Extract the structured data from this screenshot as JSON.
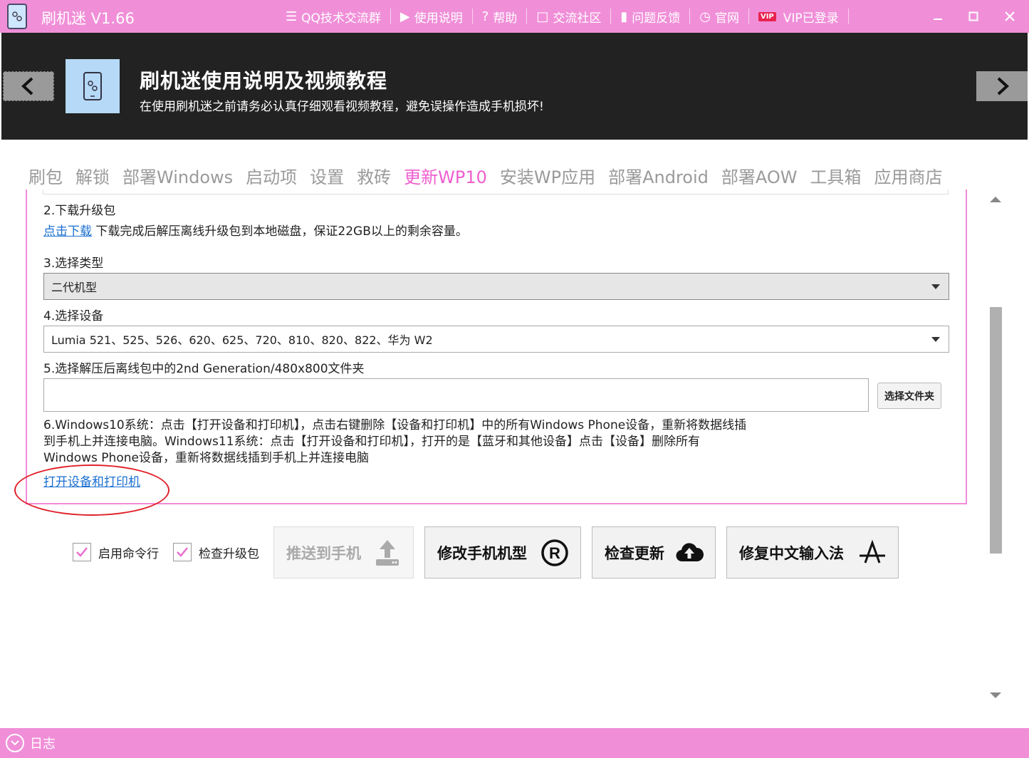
{
  "app": {
    "title": "刷机迷 V1.66"
  },
  "titlebar_menu": [
    {
      "label": "QQ技术交流群",
      "icon": "qq-group-icon"
    },
    {
      "label": "使用说明",
      "icon": "video-icon"
    },
    {
      "label": "帮助",
      "icon": "help-icon"
    },
    {
      "label": "交流社区",
      "icon": "chat-icon"
    },
    {
      "label": "问题反馈",
      "icon": "feedback-icon"
    },
    {
      "label": "官网",
      "icon": "globe-icon"
    },
    {
      "label": "VIP已登录",
      "icon": "vip-icon",
      "badge": "VIP"
    }
  ],
  "banner": {
    "title": "刷机迷使用说明及视频教程",
    "subtitle": "在使用刷机迷之前请务必认真仔细观看视频教程，避免误操作造成手机损坏!"
  },
  "tabs": [
    "刷包",
    "解锁",
    "部署Windows",
    "启动项",
    "设置",
    "救砖",
    "更新WP10",
    "安装WP应用",
    "部署Android",
    "部署AOW",
    "工具箱",
    "应用商店"
  ],
  "active_tab": "更新WP10",
  "steps": {
    "step2_title": "2.下载升级包",
    "step2_link": "点击下载",
    "step2_text": "下载完成后解压离线升级包到本地磁盘，保证22GB以上的剩余容量。",
    "step3_title": "3.选择类型",
    "step3_value": "二代机型",
    "step4_title": "4.选择设备",
    "step4_value": "Lumia 521、525、526、620、625、720、810、820、822、华为 W2",
    "step5_title": "5.选择解压后离线包中的2nd Generation/480x800文件夹",
    "step5_input_value": "",
    "step5_button": "选择文件夹",
    "step6_line1": "6.Windows10系统：点击【打开设备和打印机】，点击右键删除【设备和打印机】中的所有Windows Phone设备，重新将数据线插",
    "step6_line2": "到手机上并连接电脑。Windows11系统：点击【打开设备和打印机】，打开的是【蓝牙和其他设备】点击【设备】删除所有",
    "step6_line3": "Windows Phone设备，重新将数据线插到手机上并连接电脑",
    "step6_link": "打开设备和打印机"
  },
  "options": {
    "enable_cmd": {
      "label": "启用命令行",
      "checked": true
    },
    "check_package": {
      "label": "检查升级包",
      "checked": true
    }
  },
  "actions": {
    "push": "推送到手机",
    "change_model": "修改手机机型",
    "check_update": "检查更新",
    "fix_ime": "修复中文输入法"
  },
  "statusbar": {
    "log_label": "日志"
  },
  "colors": {
    "accent": "#f08fd8",
    "active_tab": "#ee5fcf",
    "link": "#1a6fd0",
    "annotation": "#e0202a"
  }
}
